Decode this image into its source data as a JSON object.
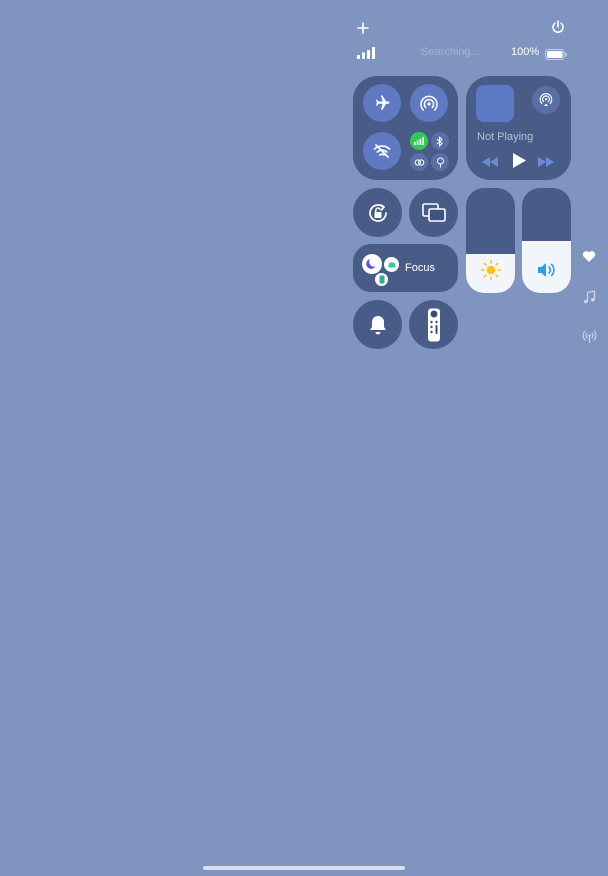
{
  "status": {
    "carrier": "Searching...",
    "battery_percent": "100%",
    "battery_level": 1.0
  },
  "header": {
    "add_icon": "plus-icon",
    "power_icon": "power-icon"
  },
  "connectivity": {
    "airplane_mode": "airplane-icon",
    "airdrop": "airdrop-icon",
    "wifi": "wifi-off-icon",
    "cellular": "cellular-icon",
    "bluetooth": "bluetooth-icon",
    "vpn": "vpn-icon",
    "hotspot": "hotspot-icon"
  },
  "media": {
    "title": "Not Playing",
    "airplay_icon": "airplay-icon",
    "rewind_icon": "rewind-icon",
    "play_icon": "play-icon",
    "forward_icon": "fast-forward-icon"
  },
  "controls": {
    "orientation_lock": "rotation-lock-icon",
    "screen_mirroring": "screen-mirroring-icon",
    "focus_label": "Focus",
    "silent": "bell-icon",
    "remote": "apple-tv-remote-icon"
  },
  "sliders": {
    "brightness_level": 0.37,
    "volume_level": 0.5
  },
  "colors": {
    "background": "#7f95c0",
    "tile": "#3a4c78",
    "active_blue": "#5f79c2",
    "cellular_green": "#34c759",
    "focus_purple": "#5856d6",
    "sun_yellow": "#f7c21b",
    "speaker_blue": "#2f9ee8"
  },
  "side_pages": [
    "heart-icon",
    "music-note-icon",
    "antenna-icon"
  ]
}
